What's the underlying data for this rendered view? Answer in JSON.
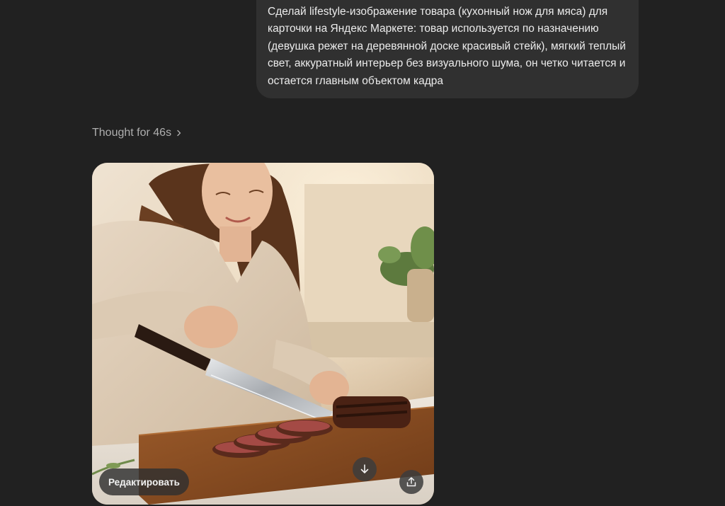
{
  "conversation": {
    "user_message": "Сделай lifestyle-изображение товара (кухонный нож для мяса) для карточки на Яндекс Маркете: товар используется по назначению (девушка режет на деревянной доске красивый стейк), мягкий теплый свет, аккуратный интерьер без визуального шума, он четко читается и остается главным объектом кадра",
    "thought_label": "Thought for 46s"
  },
  "image_card": {
    "edit_label": "Редактировать",
    "download_icon": "arrow-down-icon",
    "share_icon": "share-upload-icon"
  },
  "colors": {
    "background": "#212121",
    "bubble": "#303030",
    "text": "#ececec",
    "muted": "#afafaf"
  }
}
